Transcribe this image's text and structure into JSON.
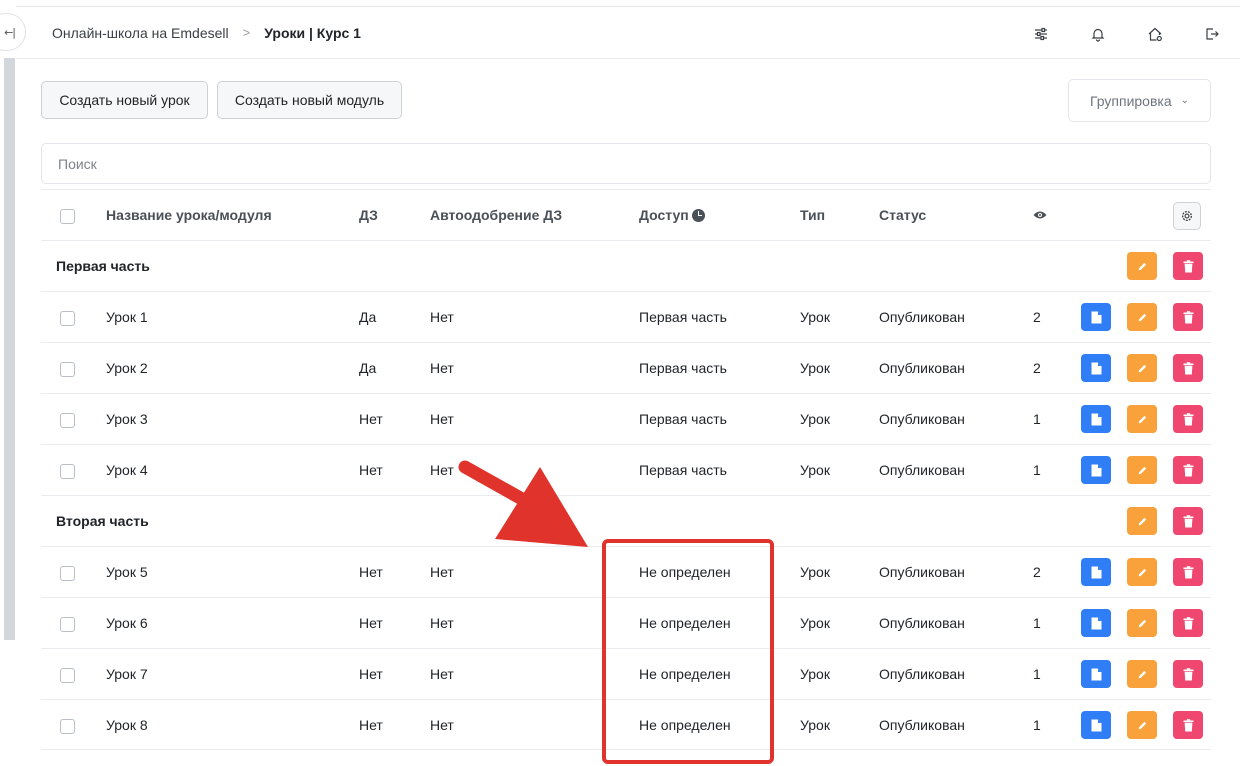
{
  "header": {
    "breadcrumb": {
      "school": "Онлайн-школа на Emdesell",
      "separator": ">",
      "current": "Уроки | Курс 1"
    },
    "collapse_glyph": "←|",
    "icons": [
      "sliders-icon",
      "bell-icon",
      "home-gear-icon",
      "logout-icon"
    ]
  },
  "toolbar": {
    "create_lesson": "Создать новый урок",
    "create_module": "Создать новый модуль",
    "grouping": "Группировка"
  },
  "search": {
    "placeholder": "Поиск"
  },
  "table": {
    "columns": {
      "name": "Название урока/модуля",
      "homework": "ДЗ",
      "auto_approve": "Автоодобрение ДЗ",
      "access": "Доступ",
      "type": "Тип",
      "status": "Статус",
      "views": "eye-icon"
    },
    "groups": [
      {
        "title": "Первая часть",
        "rows": [
          {
            "name": "Урок 1",
            "homework": "Да",
            "auto_approve": "Нет",
            "access": "Первая часть",
            "type": "Урок",
            "status": "Опубликован",
            "views": "2"
          },
          {
            "name": "Урок 2",
            "homework": "Да",
            "auto_approve": "Нет",
            "access": "Первая часть",
            "type": "Урок",
            "status": "Опубликован",
            "views": "2"
          },
          {
            "name": "Урок 3",
            "homework": "Нет",
            "auto_approve": "Нет",
            "access": "Первая часть",
            "type": "Урок",
            "status": "Опубликован",
            "views": "1"
          },
          {
            "name": "Урок 4",
            "homework": "Нет",
            "auto_approve": "Нет",
            "access": "Первая часть",
            "type": "Урок",
            "status": "Опубликован",
            "views": "1"
          }
        ]
      },
      {
        "title": "Вторая часть",
        "rows": [
          {
            "name": "Урок 5",
            "homework": "Нет",
            "auto_approve": "Нет",
            "access": "Не определен",
            "type": "Урок",
            "status": "Опубликован",
            "views": "2"
          },
          {
            "name": "Урок 6",
            "homework": "Нет",
            "auto_approve": "Нет",
            "access": "Не определен",
            "type": "Урок",
            "status": "Опубликован",
            "views": "1"
          },
          {
            "name": "Урок 7",
            "homework": "Нет",
            "auto_approve": "Нет",
            "access": "Не определен",
            "type": "Урок",
            "status": "Опубликован",
            "views": "1"
          },
          {
            "name": "Урок 8",
            "homework": "Нет",
            "auto_approve": "Нет",
            "access": "Не определен",
            "type": "Урок",
            "status": "Опубликован",
            "views": "1"
          }
        ]
      }
    ]
  },
  "colors": {
    "doc_button": "#2f7ef5",
    "edit_button": "#f9a23b",
    "delete_button": "#ef4770",
    "annotation": "#e0332b"
  }
}
